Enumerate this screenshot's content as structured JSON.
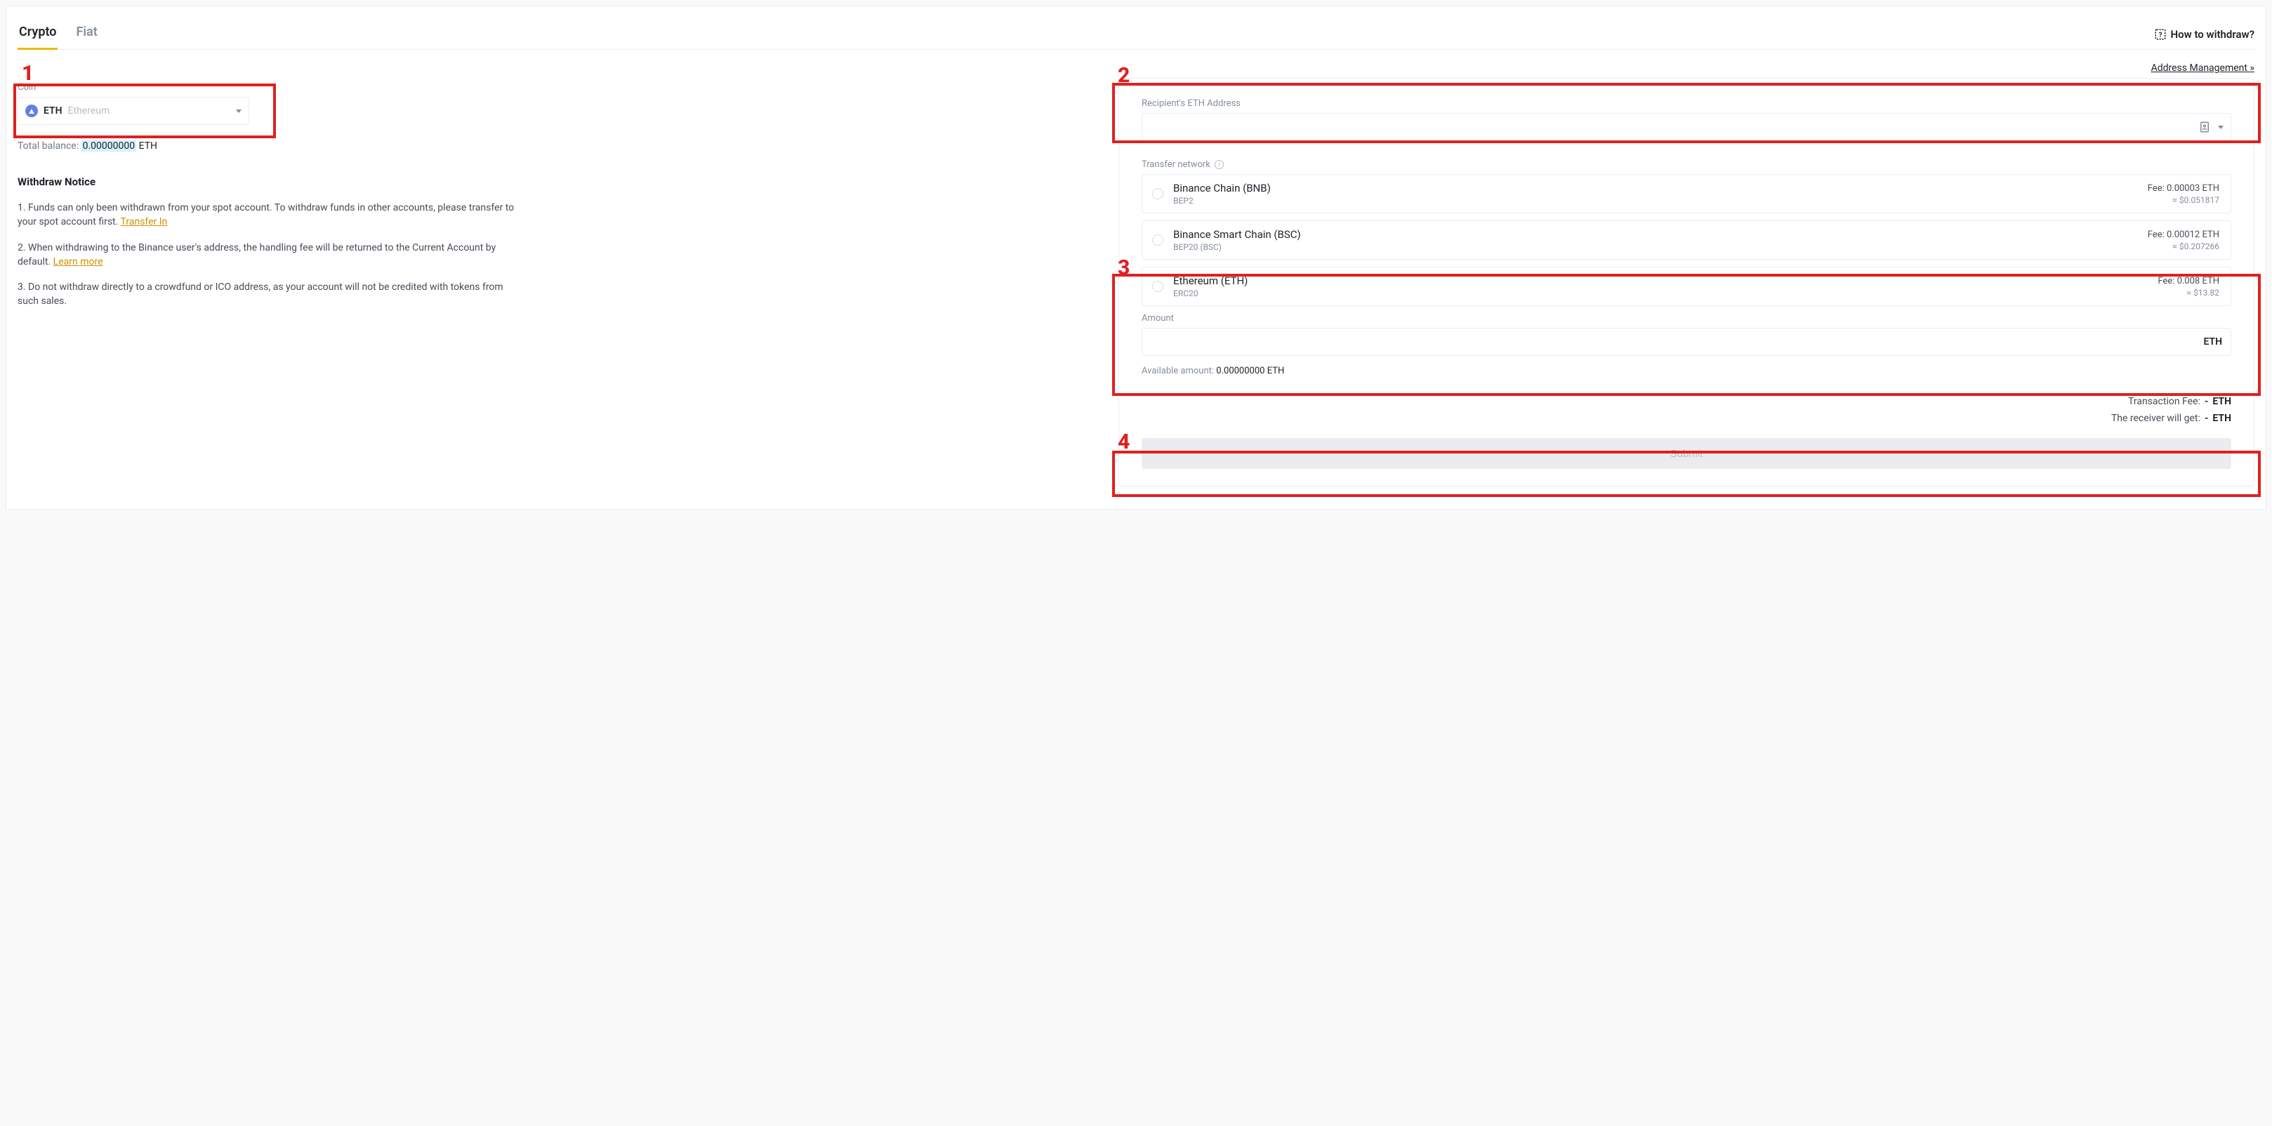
{
  "header": {
    "tabs": [
      {
        "id": "crypto",
        "label": "Crypto",
        "active": true
      },
      {
        "id": "fiat",
        "label": "Fiat",
        "active": false
      }
    ],
    "help_label": "How to withdraw?",
    "address_mgmt_label": "Address Management »"
  },
  "left": {
    "coin_label": "Coin",
    "coin_symbol": "ETH",
    "coin_name": "Ethereum",
    "total_balance_label": "Total balance:",
    "total_balance_value": "0.00000000",
    "total_balance_symbol": "ETH",
    "notice_title": "Withdraw Notice",
    "notices": [
      {
        "text_before": "1. Funds can only been withdrawn from your spot account. To withdraw funds in other accounts, please transfer to your spot account first.  ",
        "link": "Transfer In",
        "text_after": ""
      },
      {
        "text_before": "2. When withdrawing to the Binance user's address, the handling fee will be returned to the Current Account by default. ",
        "link": "Learn more",
        "text_after": ""
      },
      {
        "text_before": "3. Do not withdraw directly to a crowdfund or ICO address, as your account will not be credited with tokens from such sales.",
        "link": "",
        "text_after": ""
      }
    ]
  },
  "right": {
    "address_label": "Recipient's ETH Address",
    "address_value": "",
    "transfer_network_label": "Transfer network",
    "networks": [
      {
        "name": "Binance Chain (BNB)",
        "sub": "BEP2",
        "fee": "Fee: 0.00003 ETH",
        "fee2": "≈ $0.051817"
      },
      {
        "name": "Binance Smart Chain (BSC)",
        "sub": "BEP20 (BSC)",
        "fee": "Fee: 0.00012 ETH",
        "fee2": "≈ $0.207266"
      },
      {
        "name": "Ethereum (ETH)",
        "sub": "ERC20",
        "fee": "Fee: 0.008 ETH",
        "fee2": "≈ $13.82"
      }
    ],
    "amount_label": "Amount",
    "amount_value": "",
    "amount_symbol": "ETH",
    "available_label": "Available amount:",
    "available_value": "0.00000000 ETH",
    "tx_fee_label": "Transaction Fee:",
    "tx_fee_value": "-",
    "tx_fee_symbol": "ETH",
    "receive_label": "The receiver will get:",
    "receive_value": "-",
    "receive_symbol": "ETH",
    "submit_label": "Submit"
  },
  "annotations": {
    "n1": "1",
    "n2": "2",
    "n3": "3",
    "n4": "4"
  }
}
